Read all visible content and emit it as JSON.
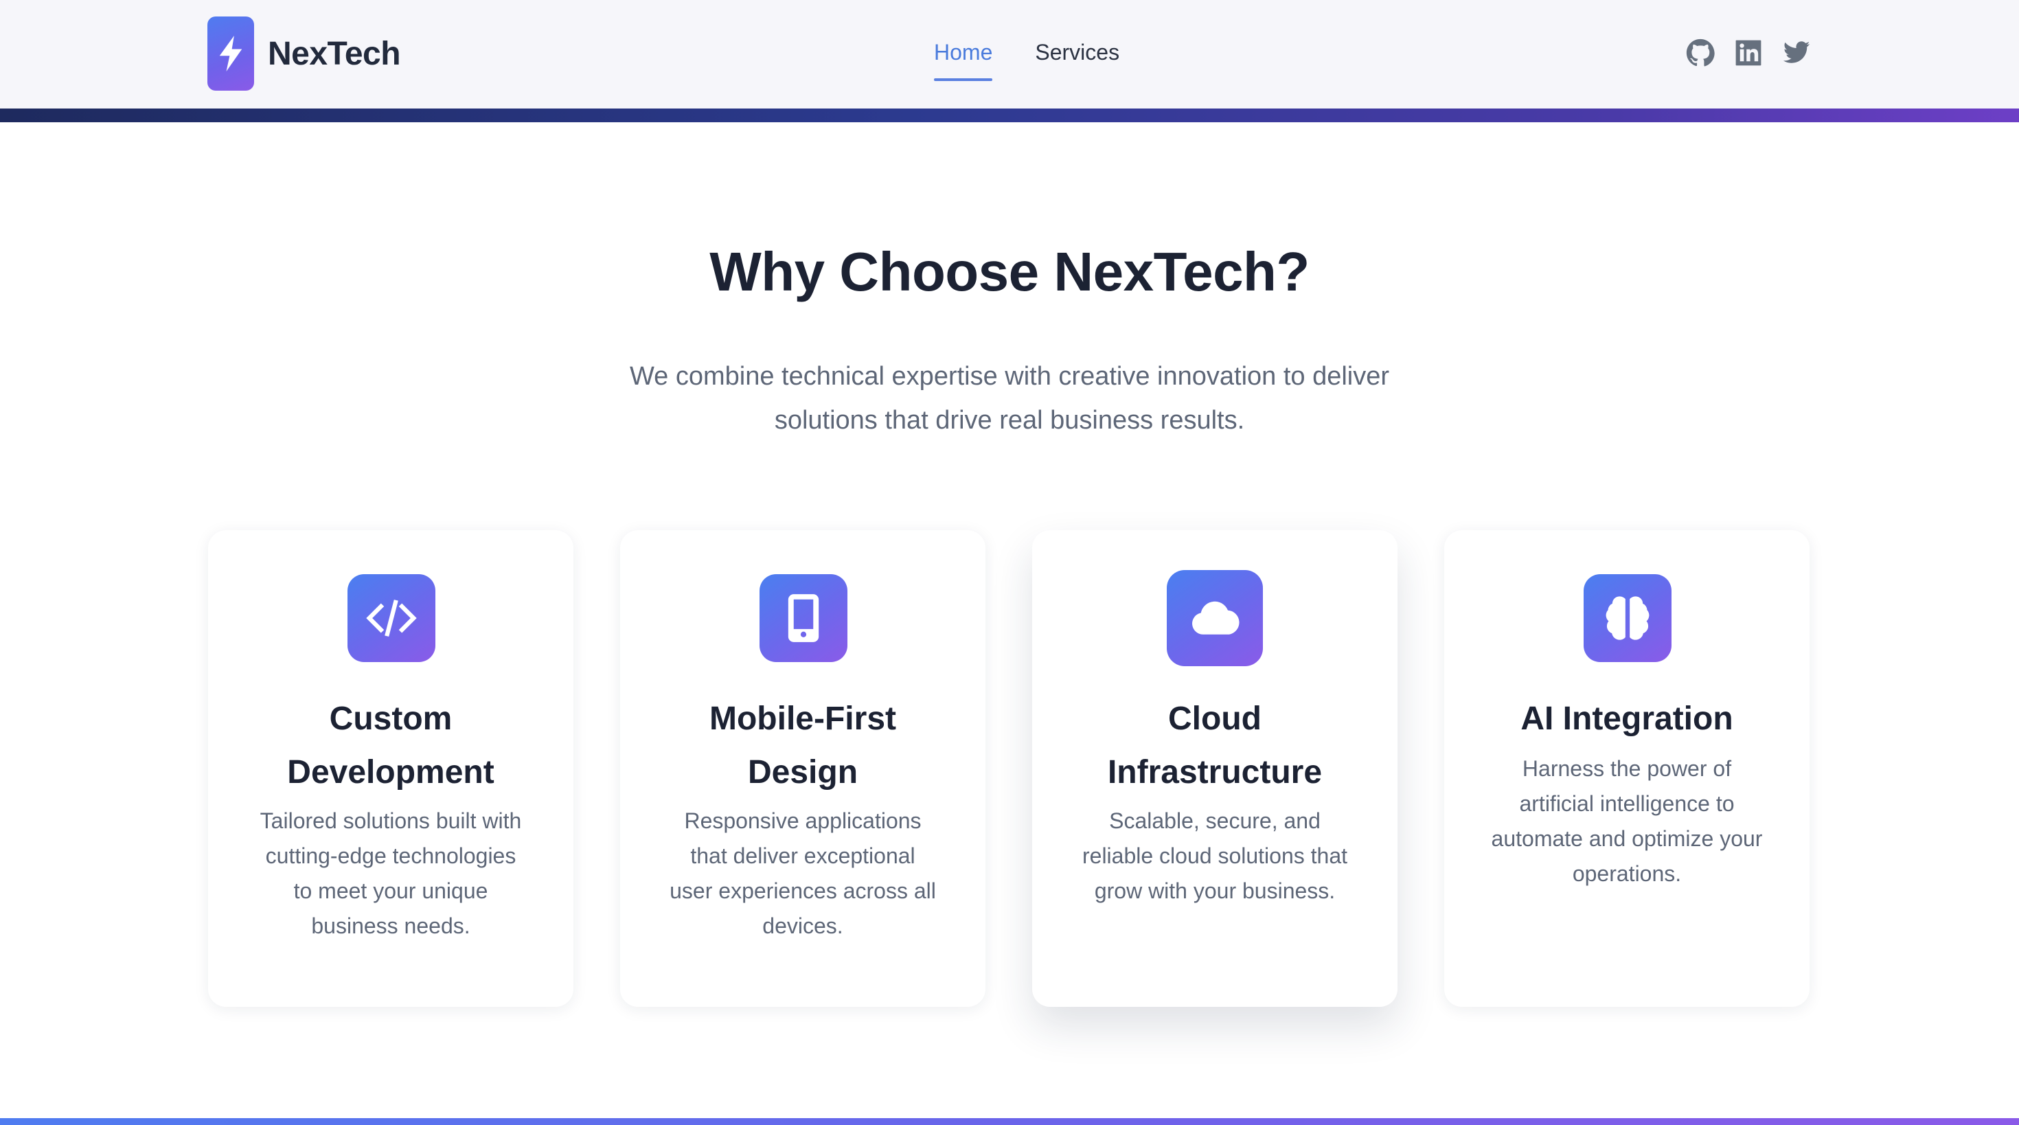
{
  "header": {
    "logo_text": "NexTech",
    "nav": [
      {
        "label": "Home",
        "active": true
      },
      {
        "label": "Services",
        "active": false
      }
    ],
    "social_icons": [
      "github-icon",
      "linkedin-icon",
      "twitter-icon"
    ]
  },
  "hero": {
    "title": "Why Choose NexTech?",
    "subtitle_line1": "We combine technical expertise with creative innovation to deliver",
    "subtitle_line2": "solutions that drive real business results."
  },
  "cards": [
    {
      "icon": "code-icon",
      "title_line1": "Custom",
      "title_line2": "Development",
      "desc_lines": [
        "Tailored solutions built with",
        "cutting-edge technologies",
        "to meet your unique",
        "business needs."
      ]
    },
    {
      "icon": "mobile-icon",
      "title_line1": "Mobile-First",
      "title_line2": "Design",
      "desc_lines": [
        "Responsive applications",
        "that deliver exceptional",
        "user experiences across all",
        "devices."
      ]
    },
    {
      "icon": "cloud-icon",
      "title_line1": "Cloud",
      "title_line2": "Infrastructure",
      "desc_lines": [
        "Scalable, secure, and",
        "reliable cloud solutions that",
        "grow with your business."
      ]
    },
    {
      "icon": "brain-icon",
      "title_line1": "AI Integration",
      "desc_lines": [
        "Harness the power of",
        "artificial intelligence to",
        "automate and optimize your",
        "operations."
      ]
    }
  ],
  "colors": {
    "accent": "#4a7bdc",
    "gradient_start": "#4a7ff0",
    "gradient_end": "#8a5be8",
    "heading": "#1c2233",
    "body_text": "#5d6677"
  }
}
